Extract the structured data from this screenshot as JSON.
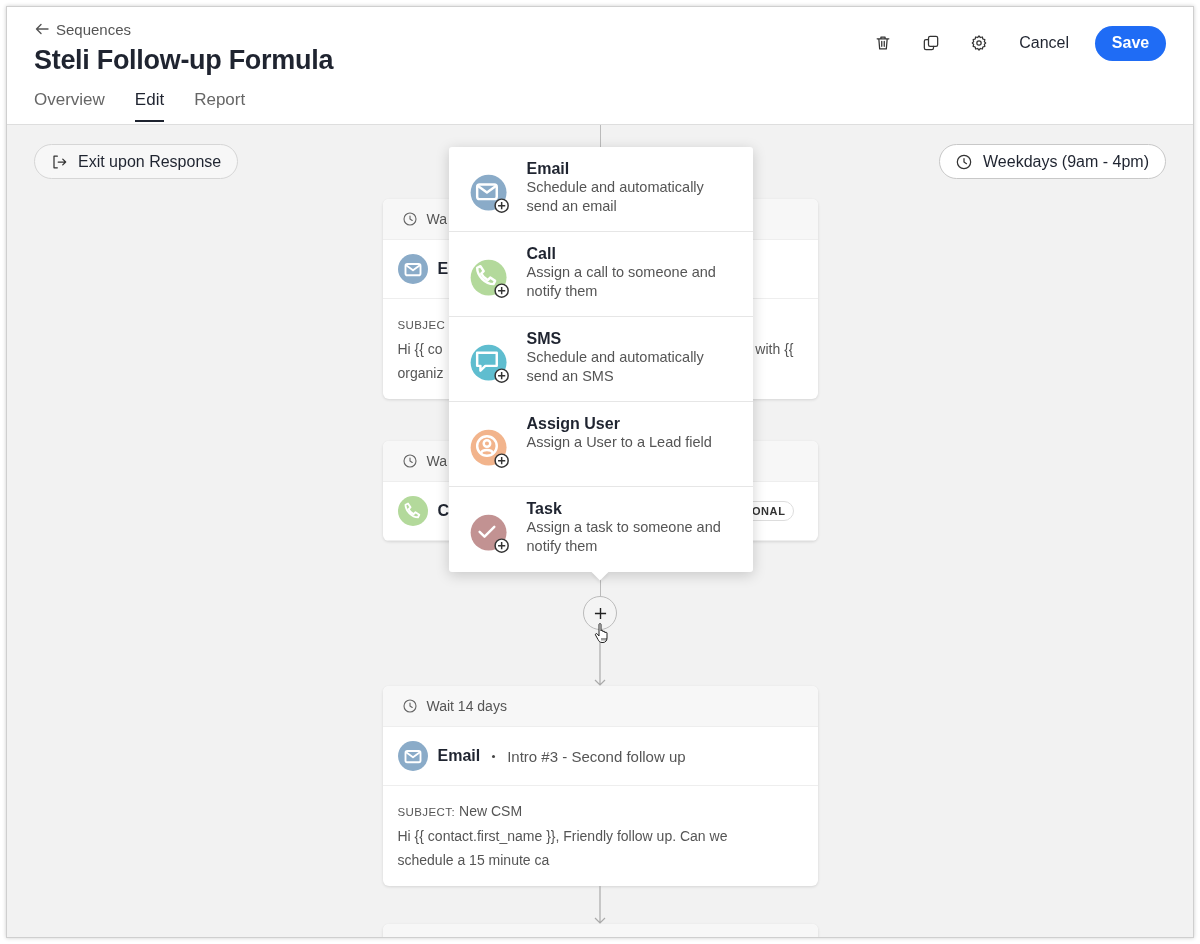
{
  "header": {
    "back_link": "Sequences",
    "title": "Steli Follow-up Formula",
    "tabs": [
      {
        "label": "Overview",
        "selected": false
      },
      {
        "label": "Edit",
        "selected": true
      },
      {
        "label": "Report",
        "selected": false
      }
    ],
    "cancel": "Cancel",
    "save": "Save"
  },
  "canvas": {
    "exit_button": "Exit upon Response",
    "schedule_button": "Weekdays (9am - 4pm)",
    "steps": [
      {
        "kind": "email",
        "wait": "Wa",
        "title": "E",
        "subject_label": "SUBJEC",
        "body": [
          {
            "left": "Hi {{ co",
            "right": "with {{"
          },
          {
            "left": "organiz"
          }
        ]
      },
      {
        "kind": "call",
        "wait": "Wa",
        "title": "C",
        "badge": "ONAL"
      },
      {
        "kind": "email",
        "wait": "Wait 14 days",
        "title": "Email",
        "subtitle": "Intro #3 - Second follow up",
        "subject_label": "SUBJECT:",
        "subject": "New CSM",
        "body": [
          {
            "left": "Hi {{ contact.first_name }}, Friendly follow up. Can we"
          },
          {
            "left": "schedule a 15 minute ca"
          }
        ]
      },
      {
        "kind": "cut_off"
      }
    ],
    "add_menu": {
      "items": [
        {
          "kind": "email",
          "title": "Email",
          "description": "Schedule and automatically send an email"
        },
        {
          "kind": "call",
          "title": "Call",
          "description": "Assign a call to someone and notify them"
        },
        {
          "kind": "sms",
          "title": "SMS",
          "description": "Schedule and automatically send an SMS"
        },
        {
          "kind": "assign_user",
          "title": "Assign User",
          "description": "Assign a User to a Lead field"
        },
        {
          "kind": "task",
          "title": "Task",
          "description": "Assign a task to someone and notify them"
        }
      ]
    }
  }
}
